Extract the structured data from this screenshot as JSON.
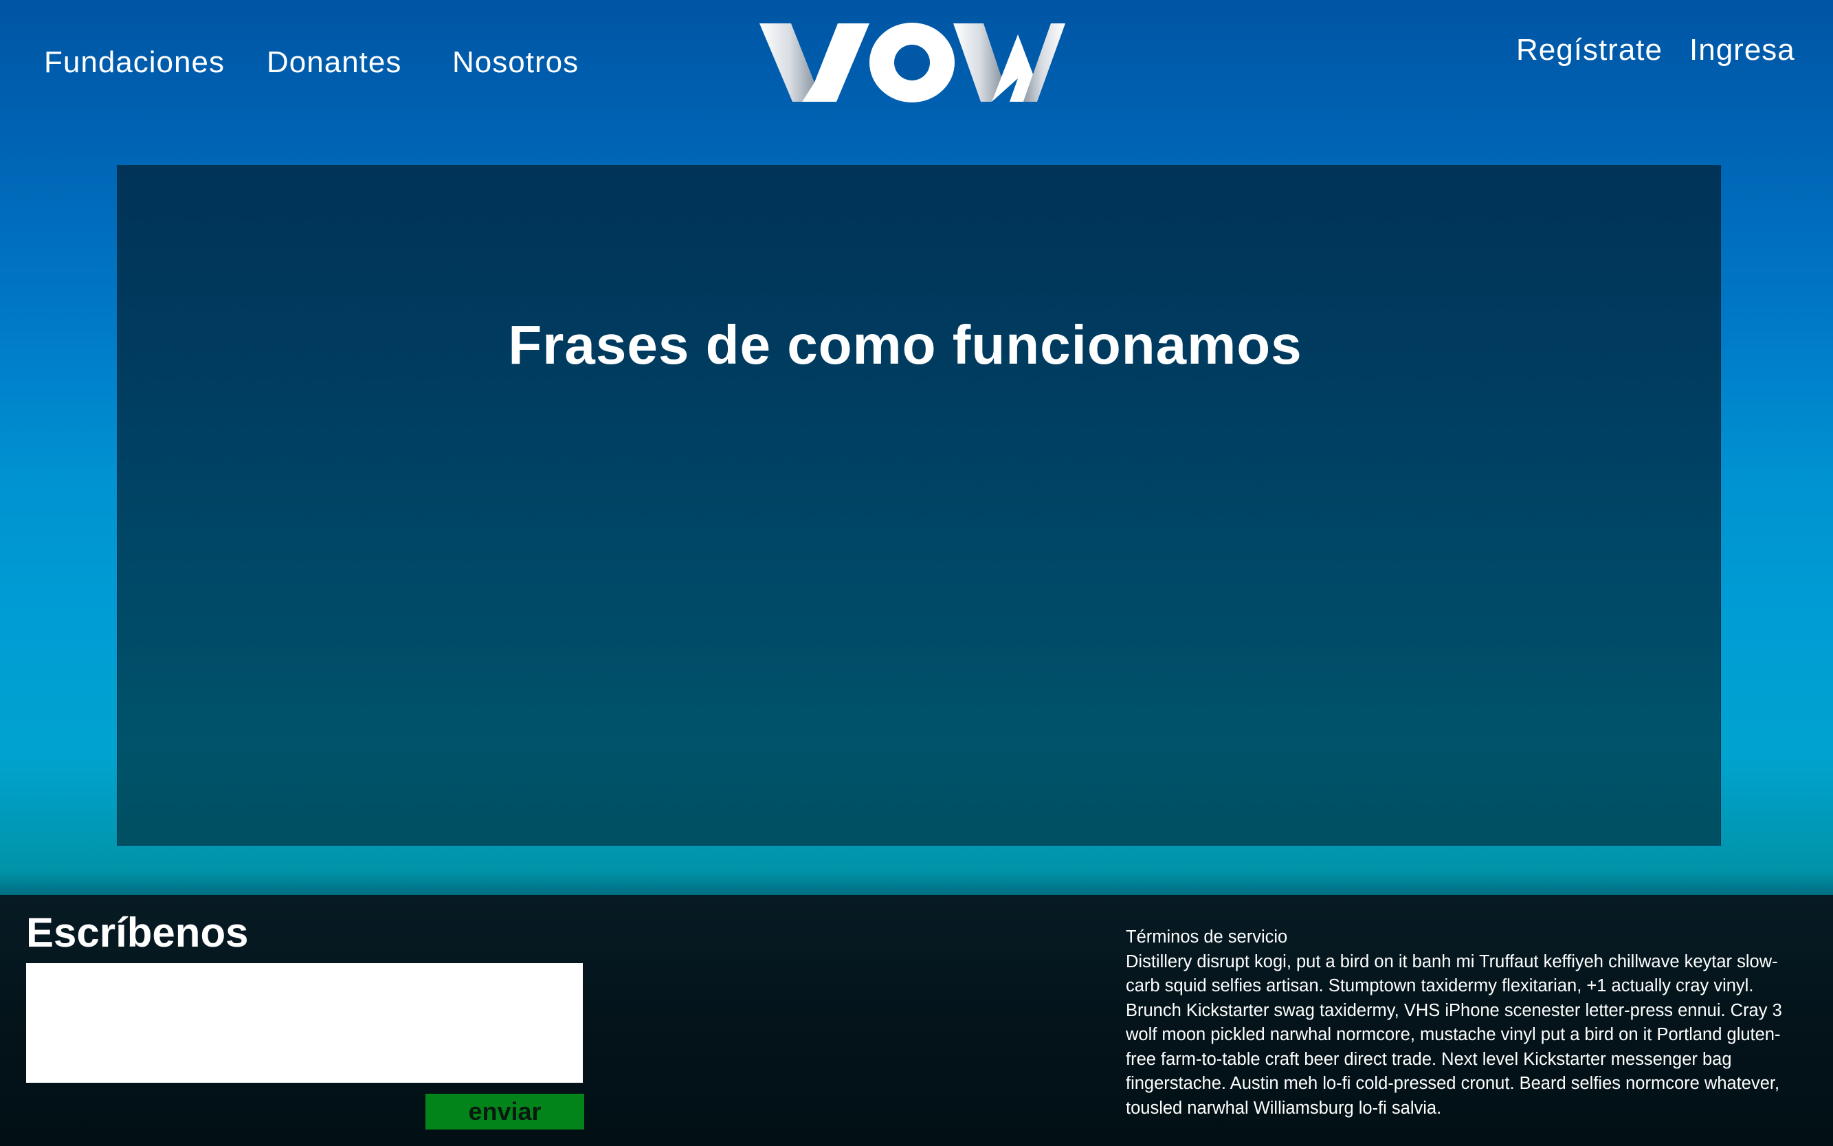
{
  "header": {
    "nav_left": {
      "fundaciones": "Fundaciones",
      "donantes": "Donantes",
      "nosotros": "Nosotros"
    },
    "logo_text": "VOW",
    "nav_right": {
      "registrate": "Regístrate",
      "ingresa": "Ingresa"
    }
  },
  "hero": {
    "title": "Frases de como funcionamos"
  },
  "footer": {
    "contact": {
      "title": "Escríbenos",
      "message_value": "",
      "send_label": "enviar"
    },
    "terms": {
      "title": "Términos de servicio",
      "body": "Distillery disrupt kogi, put a bird on it banh mi Truffaut keffiyeh chillwave keytar slow-carb squid selfies artisan. Stumptown taxidermy flexitarian, +1 actually cray vinyl. Brunch Kickstarter swag taxidermy, VHS iPhone scenester letter-press ennui. Cray 3 wolf moon pickled narwhal normcore, mustache vinyl put a bird on it Portland gluten-free farm-to-table craft beer direct trade. Next level Kickstarter messenger bag fingerstache. Austin meh lo-fi cold-pressed cronut. Beard selfies normcore whatever, tousled narwhal Williamsburg lo-fi salvia."
    }
  },
  "colors": {
    "background_top": "#0055a4",
    "background_bottom": "#00a3cf",
    "hero_panel": "#003c60",
    "footer": "#04141b",
    "send_button": "#03841a",
    "text": "#ffffff"
  }
}
